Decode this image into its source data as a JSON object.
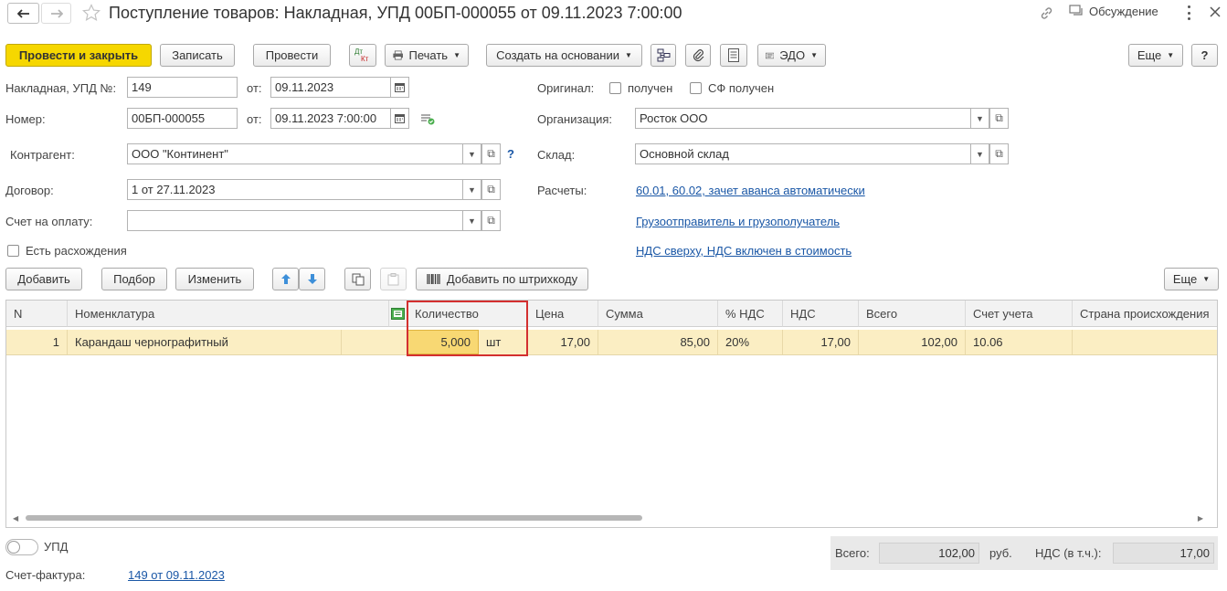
{
  "window": {
    "title": "Поступление товаров: Накладная, УПД 00БП-000055 от 09.11.2023 7:00:00",
    "discussion_label": "Обсуждение",
    "icons": [
      "back-arrow-icon",
      "forward-arrow-icon",
      "star-icon",
      "link-icon",
      "discussion-icon",
      "more-vert-icon",
      "close-icon"
    ]
  },
  "toolbar": {
    "post_close": "Провести и закрыть",
    "save": "Записать",
    "post": "Провести",
    "dt_kt_top": "Дт",
    "dt_kt_bottom": "Кт",
    "print": "Печать",
    "create_based": "Создать на основании",
    "edo": "ЭДО",
    "more": "Еще",
    "help": "?"
  },
  "form": {
    "invoice_label": "Накладная, УПД №:",
    "invoice_value": "149",
    "from_label": "от:",
    "invoice_date": "09.11.2023",
    "number_label": "Номер:",
    "number_value": "00БП-000055",
    "number_date": "09.11.2023  7:00:00",
    "counterparty_label": "Контрагент:",
    "counterparty_value": "ООО \"Континент\"",
    "question_mark": "?",
    "contract_label": "Договор:",
    "contract_value": "1 от 27.11.2023",
    "payment_account_label": "Счет на оплату:",
    "payment_account_value": "",
    "discrepancy_label": "Есть расхождения",
    "original_label": "Оригинал:",
    "received_label": "получен",
    "sf_received_label": "СФ получен",
    "organization_label": "Организация:",
    "organization_value": "Росток ООО",
    "warehouse_label": "Склад:",
    "warehouse_value": "Основной склад",
    "settlements_label": "Расчеты:",
    "settlements_link": "60.01, 60.02, зачет аванса автоматически",
    "shipper_link": "Грузоотправитель и грузополучатель",
    "vat_link": "НДС сверху, НДС включен в стоимость"
  },
  "table_toolbar": {
    "add": "Добавить",
    "pick": "Подбор",
    "edit": "Изменить",
    "add_barcode": "Добавить по штрихкоду",
    "more": "Еще"
  },
  "table": {
    "columns": [
      "N",
      "Номенклатура",
      "Количество",
      "Цена",
      "Сумма",
      "% НДС",
      "НДС",
      "Всего",
      "Счет учета",
      "Страна происхождения"
    ],
    "rows": [
      {
        "n": "1",
        "item": "Карандаш чернографитный",
        "qty": "5,000",
        "unit": "шт",
        "price": "17,00",
        "sum": "85,00",
        "vat_rate": "20%",
        "vat": "17,00",
        "total": "102,00",
        "account": "10.06",
        "country": ""
      }
    ],
    "highlight_color": "#d32f2f",
    "row_color": "#fbeec3"
  },
  "footer": {
    "upd_label": "УПД",
    "invoice_label": "Счет-фактура:",
    "invoice_link": "149 от 09.11.2023",
    "total_label": "Всего:",
    "total_value": "102,00",
    "currency": "руб.",
    "vat_label": "НДС (в т.ч.):",
    "vat_value": "17,00"
  },
  "colors": {
    "primary_button": "#f6d700",
    "link": "#1a57a6",
    "selected_row": "#fbeec3"
  }
}
